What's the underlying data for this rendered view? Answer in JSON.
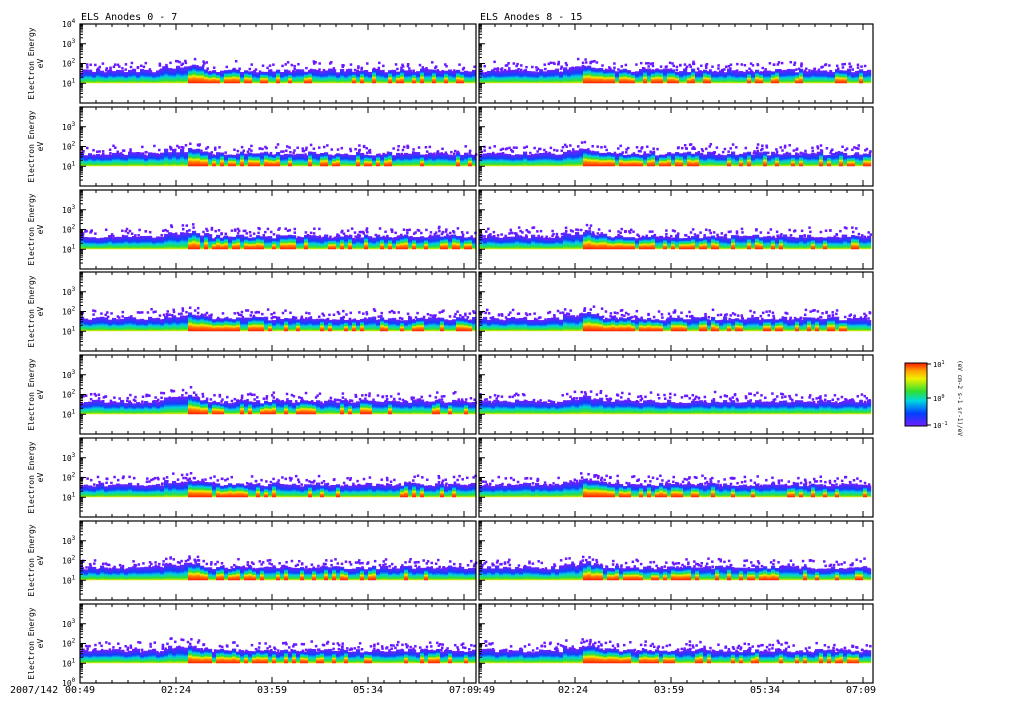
{
  "chart_data": {
    "type": "heatmap",
    "titles": [
      "ELS Anodes 0 - 7",
      "ELS Anodes 8 - 15"
    ],
    "ylabel": "Electron Energy",
    "yunit": "eV",
    "yscale": "log",
    "ylim": [
      1,
      10000
    ],
    "yticks_top_panel": [
      "10",
      "10",
      "10",
      "10"
    ],
    "yticks_top_panel_exp": [
      "4",
      "3",
      "2",
      "1"
    ],
    "yticks": [
      "10",
      "10",
      "10"
    ],
    "yticks_exp": [
      "3",
      "2",
      "1"
    ],
    "yticks_bottom_extra": {
      "base": "10",
      "exp": "0"
    },
    "date_label": "2007/142",
    "xtick_labels": [
      "00:49",
      "02:24",
      "03:59",
      "05:34",
      "07:09"
    ],
    "xlim": [
      "00:49",
      "07:13"
    ],
    "rows": 8,
    "event_time": "02:30",
    "colorbar": {
      "ticks": [
        {
          "base": "10",
          "exp": "1"
        },
        {
          "base": "10",
          "exp": "0"
        },
        {
          "base": "10",
          "exp": "-1"
        }
      ],
      "label": "(eV cm-2 s-1 sr-1)/eV",
      "colors": [
        "#ff1a00",
        "#ffa000",
        "#f0f000",
        "#30e030",
        "#00d8e0",
        "#0040ff",
        "#7020ff"
      ]
    }
  }
}
